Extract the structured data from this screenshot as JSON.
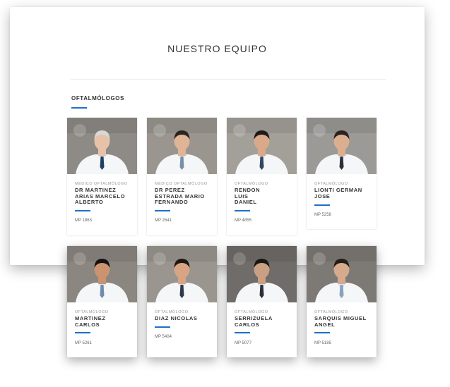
{
  "page": {
    "title": "NUESTRO EQUIPO"
  },
  "section": {
    "title": "OFTALMÓLOGOS"
  },
  "colors": {
    "accent": "#1f6fc4",
    "text": "#333333",
    "muted": "#9a9a9a"
  },
  "doctors": [
    {
      "role": "MÉDICO OFTALMÓLOGO",
      "name": "DR MARTINEZ ARIAS MARCELO ALBERTO",
      "mp": "MP 1863"
    },
    {
      "role": "MÉDICO OFTALMÓLOGO",
      "name": "DR PEREZ ESTRADA MARIO FERNANDO",
      "mp": "MP 2641"
    },
    {
      "role": "OFTALMÓLOGO",
      "name": "RENDON LUIS DANIEL",
      "mp": "MP 4855"
    },
    {
      "role": "OFTALMÓLOGO",
      "name": "LIONTI GERMAN JOSE",
      "mp": "MP 5258"
    },
    {
      "role": "OFTALMÓLOGO",
      "name": "MARTINEZ CARLOS",
      "mp": "MP 5261"
    },
    {
      "role": "OFTALMÓLOGO",
      "name": "DIAZ NICOLAS",
      "mp": "MP 5404"
    },
    {
      "role": "OFTALMÓLOGO",
      "name": "SERRIZUELA CARLOS",
      "mp": "MP 5077"
    },
    {
      "role": "OFTALMÓLOGO",
      "name": "SARQUIS MIGUEL ANGEL",
      "mp": "MP 5185"
    }
  ]
}
